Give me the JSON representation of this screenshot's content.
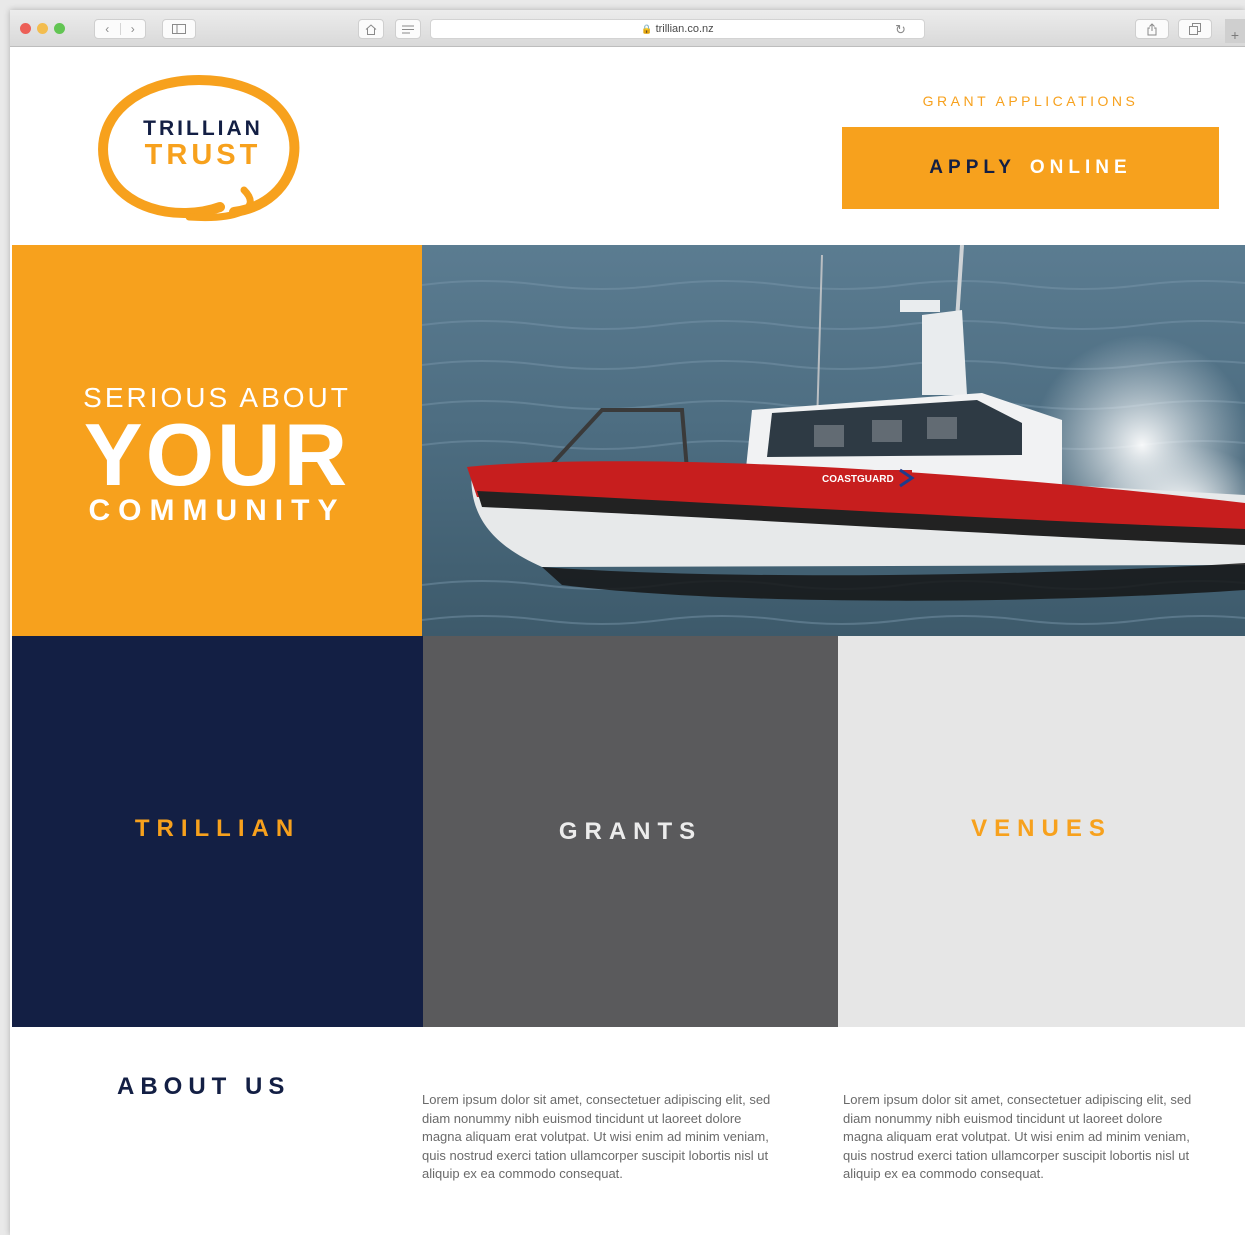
{
  "browser": {
    "url": "trillian.co.nz",
    "icons": {
      "back": "chevron-left-icon",
      "forward": "chevron-right-icon",
      "sidebar": "sidebar-icon",
      "home": "home-icon",
      "reader": "reader-icon",
      "reload": "reload-icon",
      "share": "share-icon",
      "tabs": "tabs-icon",
      "new_tab": "plus-icon"
    }
  },
  "header": {
    "logo": {
      "line1": "TRILLIAN",
      "line2": "TRUST"
    },
    "grant_link": "GRANT APPLICATIONS",
    "apply": {
      "word1": "APPLY",
      "word2": "ONLINE"
    }
  },
  "hero": {
    "line1": "SERIOUS ABOUT",
    "line2": "YOUR",
    "line3": "COMMUNITY",
    "photo": {
      "boat_label": "COASTGUARD"
    }
  },
  "tiles": [
    {
      "label": "TRILLIAN"
    },
    {
      "label": "GRANTS"
    },
    {
      "label": "VENUES"
    }
  ],
  "about": {
    "heading": "ABOUT US",
    "paragraphs": [
      "Lorem ipsum dolor sit amet, consectetuer adipiscing elit, sed diam nonummy nibh euismod tincidunt ut laoreet dolore magna aliquam erat volutpat. Ut wisi enim ad minim veniam, quis nostrud exerci tation ullamcorper suscipit lobortis nisl ut aliquip ex ea commodo consequat.",
      "Lorem ipsum dolor sit amet, consectetuer adipiscing elit, sed diam nonummy nibh euismod tincidunt ut laoreet dolore magna aliquam erat volutpat. Ut wisi enim ad minim veniam, quis nostrud exerci tation ullamcorper suscipit lobortis nisl ut aliquip ex ea commodo consequat."
    ]
  },
  "colors": {
    "brand_orange": "#f7a11d",
    "brand_navy": "#131f44",
    "tile_grey": "#5a5a5c",
    "tile_light": "#e6e6e6"
  }
}
